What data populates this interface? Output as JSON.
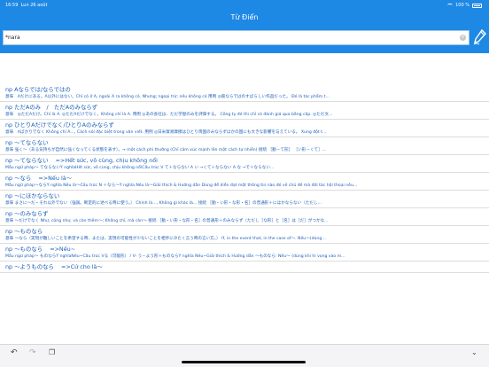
{
  "status_bar": {
    "time": "16:59",
    "date": "Lun 26 août",
    "battery": "100 %"
  },
  "header": {
    "title": "Từ Điển"
  },
  "search": {
    "value": "*nara",
    "placeholder": ""
  },
  "entries": [
    {
      "head": "np Aならでは/ならではの",
      "def": "意味　Aだけにある。A以外にはない。Chỉ có ở A, ngoài A ra không có. Nhưng; ngoại trừ; nếu không có  用例 ◎彼ならではのすばらしい作品だった。 Đó là tác phẩm t…"
    },
    {
      "head": "np ただAのみ　/　ただAのみならず",
      "def": "意味　◎ただAだけ。Chỉ là A. ◎ただAだけでなく。Không chỉ là A. 用例 ◎あの会社は、ただ学歴のみを評価する。 Công ty đó thì chỉ có đánh giá qua bằng cấp. ◎ただ文…"
    },
    {
      "head": "np ひとりAだけでなく/ひとりAのみならず",
      "def": "意味　Aばかりでなく Không chỉ A…, Cách nói đặc biệt trong văn viết.  用例 ◎日米貿易摩擦はひとり両国のみならずほかの国にも大きな影響を与えている。 Xung đột t…"
    },
    {
      "head": "np ～てならない",
      "def": "意味 強く～（ある気持ちが自然に強くなってくる状態を表す）。→ một cách phi thường (Chỉ cảm xúc mạnh lên một cách tự nhiên)  接続 ［動－て形］ ［い形－くて］…"
    },
    {
      "head": "np ～てならない    =>Hết sức, vô cùng, chịu không nổi",
      "def": "Mẫu ngữ pháp～ てならないÝ nghĩaHết sức, vô cùng, chịu không nổiCấu trúc V て＋ならない                 A い →くて＋ならない      A な →で＋ならない…"
    },
    {
      "head": "np ～なら    =>Nếu là～",
      "def": "Mẫu ngữ pháp～ならÝ nghĩa Nếu là～Cấu trúc N ＋なら～Ý nghĩa Nếu là～Giải thích & Hướng dẫn Dùng để diễn đạt một thông tin nào đó về chủ đề mà đối tác hội thoại nêu…"
    },
    {
      "head": "np ～にほかならない",
      "def": "意味 まさに～だ・それ以外でない（強調。断定的に述べる時に使う。） Chính là…, Không gì khác là…  接続 ［動・い形・な形・名］の普通形＋にほかならない（ただし…"
    },
    {
      "head": "np ～のみならず",
      "def": "意味 ～だけでなく Như, cũng như, và còn thêm～; Không chỉ, mà còn～  接続 ［動・い形・な形・名］の普通形＋のみならず（ただし［な形］と［名］は［だ］がつかな…"
    },
    {
      "head": "np ～ものなら",
      "def": "意味 ～なら（実現が難しいことを希望する時、または、実現の可能性が少ないことを相手に冷たく言う時の言い方。） If, in the event that, in the case of～. Nếu～(dùng…"
    },
    {
      "head": "np ～ものなら    =>Nếu~",
      "def": "Mẫu ngữ pháp～ ものならÝ nghĩaNếu~Cấu trúc Vる（可能形） / V- う・よう形＋ものならÝ nghĩa Nếu~Giải thích & Hướng dẫn ～ものなら: Nếu～ (dùng khi hi vọng vào m…"
    },
    {
      "head": "np ～ようものなら    =>Cứ cho là～",
      "def": ""
    }
  ],
  "icons": {
    "pen": "pen-icon",
    "undo": "undo-icon",
    "redo": "redo-icon",
    "copy": "copy-icon",
    "collapse": "chevron-down-icon"
  }
}
